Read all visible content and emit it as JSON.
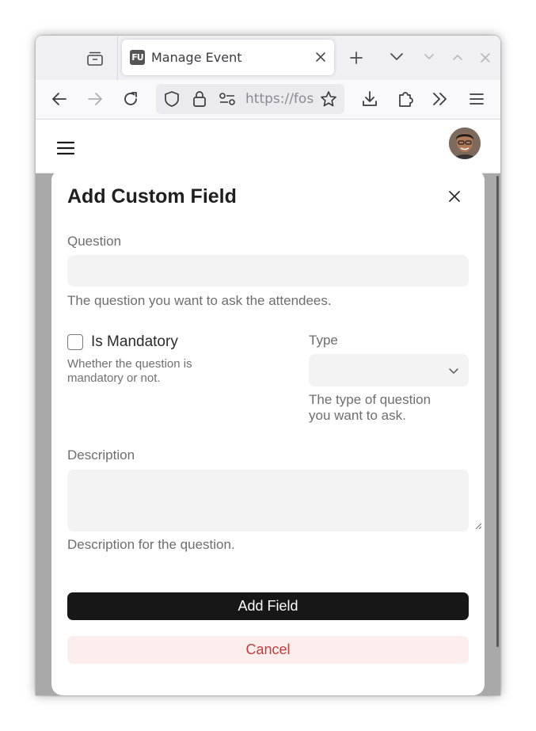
{
  "browser": {
    "tab_title": "Manage Event",
    "favicon_text": "FU",
    "url_text": "https://fossunited.org",
    "icons": [
      "tab-list-icon",
      "new-tab-icon",
      "list-all-tabs-icon",
      "back-icon",
      "forward-icon",
      "reload-icon",
      "shield-icon",
      "lock-icon",
      "permissions-icon",
      "bookmark-star-icon",
      "downloads-icon",
      "extensions-icon",
      "overflow-chevrons-icon",
      "app-menu-icon"
    ]
  },
  "app": {
    "menu_icon": "hamburger-icon",
    "avatar_icon": "user-avatar"
  },
  "modal": {
    "title": "Add Custom Field",
    "question_label": "Question",
    "question_value": "",
    "question_help": "The question you want to ask the attendees.",
    "mandatory_label": "Is Mandatory",
    "mandatory_checked": false,
    "mandatory_help_line1": "Whether the question is",
    "mandatory_help_line2": "mandatory or not.",
    "type_label": "Type",
    "type_value": "",
    "type_help_line1": "The type of question",
    "type_help_line2": "you want to ask.",
    "description_label": "Description",
    "description_value": "",
    "description_help": "Description for the question.",
    "add_button": "Add Field",
    "cancel_button": "Cancel"
  },
  "colors": {
    "primary_button": "#171717",
    "cancel_button_bg": "#fdeeee",
    "cancel_button_text": "#c53a3a",
    "input_bg": "#f3f3f3",
    "backdrop": "#a9a9a9"
  }
}
